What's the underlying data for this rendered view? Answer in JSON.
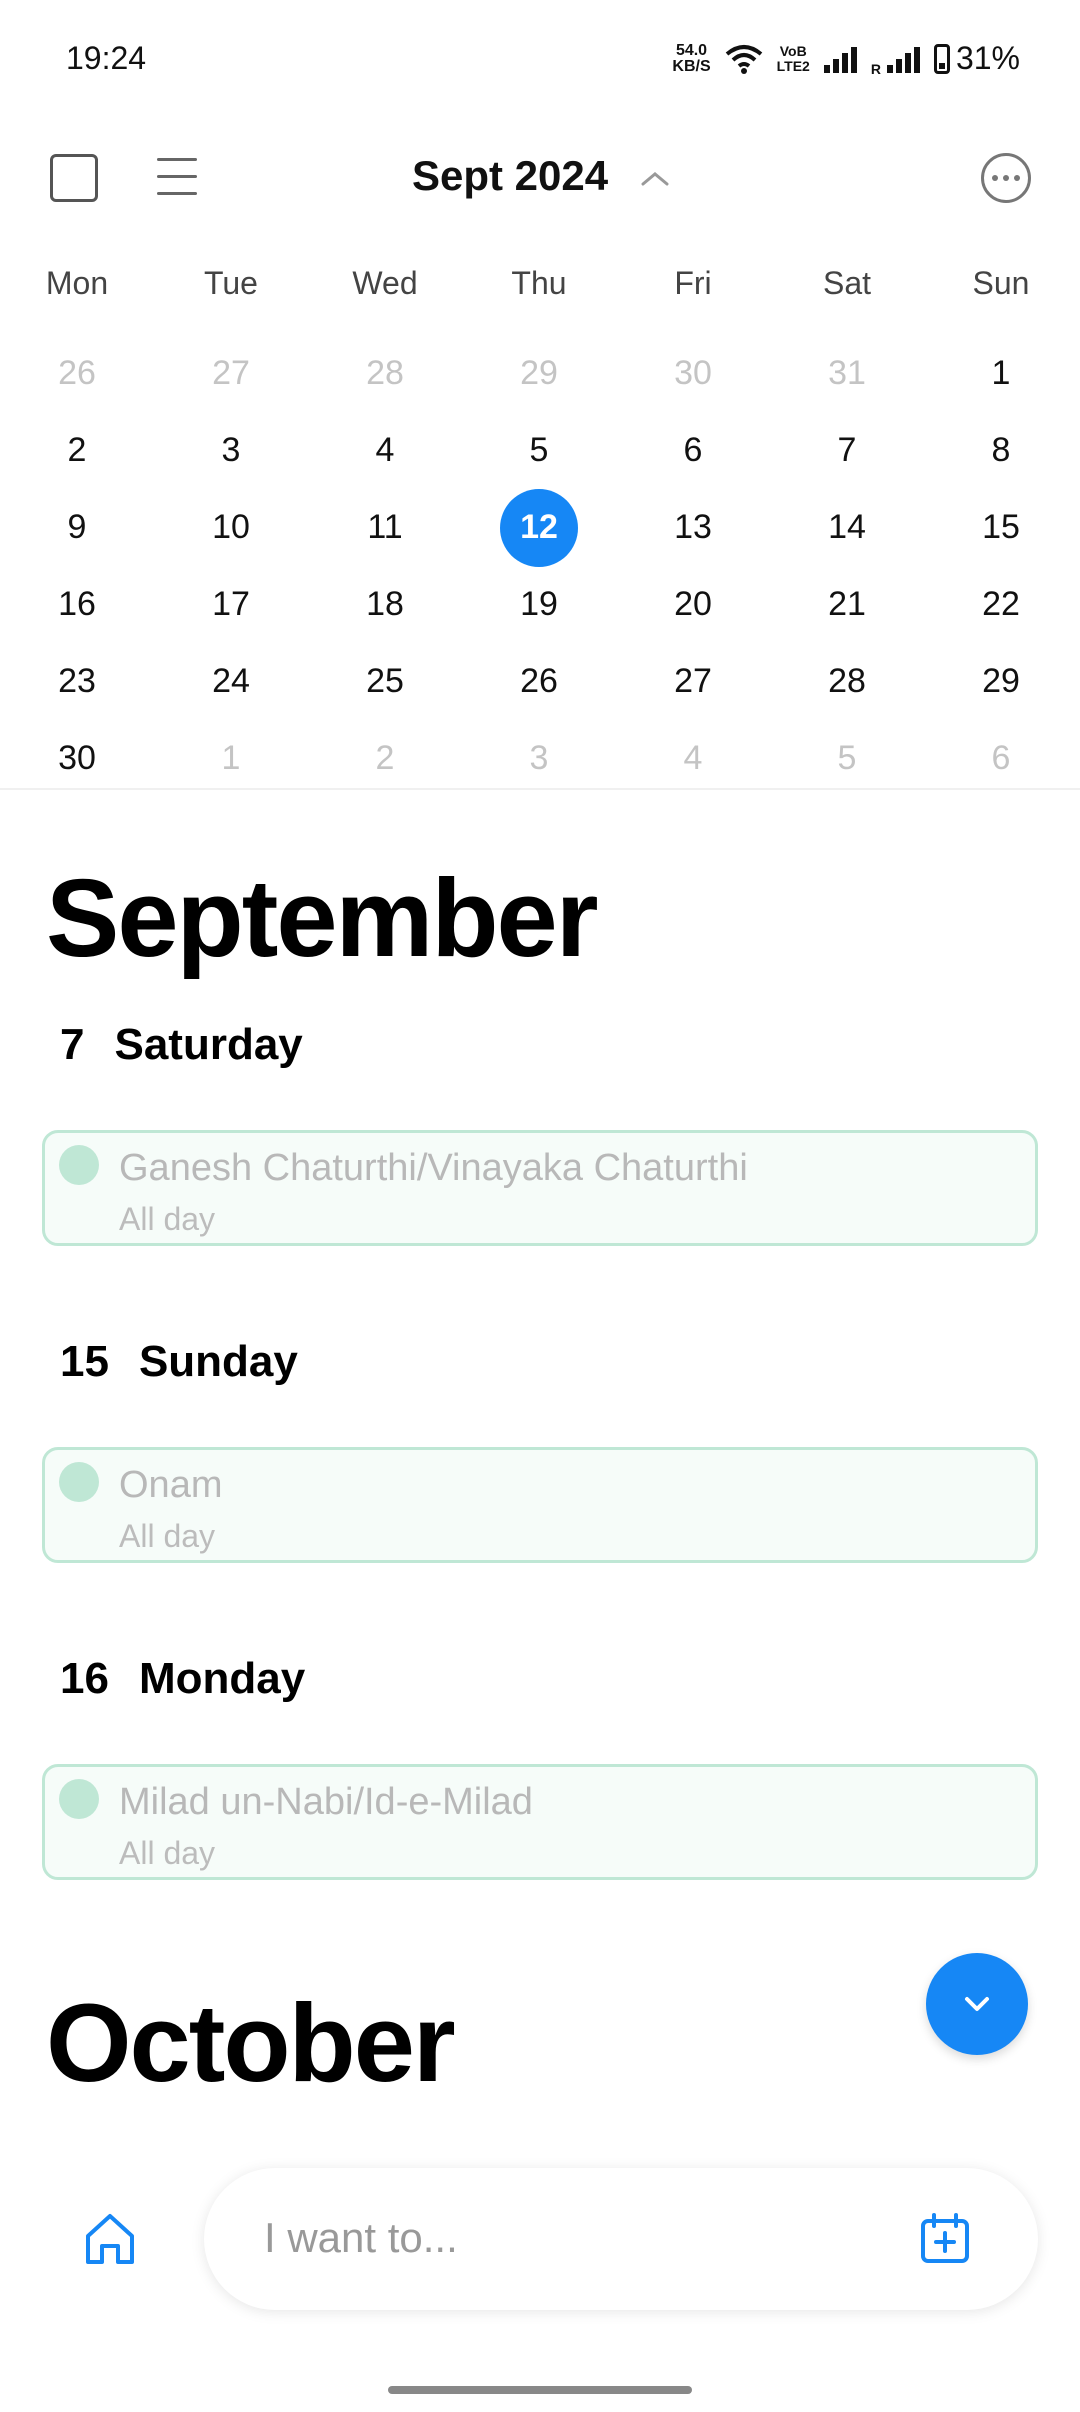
{
  "status": {
    "time": "19:24",
    "net_speed_value": "54.0",
    "net_speed_unit": "KB/S",
    "volte_top": "VoB",
    "volte_bottom": "LTE2",
    "roaming": "R",
    "battery": "31%"
  },
  "header": {
    "month_title": "Sept 2024",
    "left_icon_1": "square-icon",
    "left_icon_2": "menu-icon",
    "right_icon": "more-icon"
  },
  "calendar": {
    "weekdays": [
      "Mon",
      "Tue",
      "Wed",
      "Thu",
      "Fri",
      "Sat",
      "Sun"
    ],
    "weeks": [
      [
        "26",
        "27",
        "28",
        "29",
        "30",
        "31",
        "1"
      ],
      [
        "2",
        "3",
        "4",
        "5",
        "6",
        "7",
        "8"
      ],
      [
        "9",
        "10",
        "11",
        "12",
        "13",
        "14",
        "15"
      ],
      [
        "16",
        "17",
        "18",
        "19",
        "20",
        "21",
        "22"
      ],
      [
        "23",
        "24",
        "25",
        "26",
        "27",
        "28",
        "29"
      ],
      [
        "30",
        "1",
        "2",
        "3",
        "4",
        "5",
        "6"
      ]
    ],
    "today": "12",
    "today_color": "#1687f5"
  },
  "agenda": {
    "month1": "September",
    "days": [
      {
        "num": "7",
        "weekday": "Saturday",
        "event_title": "Ganesh Chaturthi/Vinayaka Chaturthi",
        "event_time": "All day"
      },
      {
        "num": "15",
        "weekday": "Sunday",
        "event_title": "Onam",
        "event_time": "All day"
      },
      {
        "num": "16",
        "weekday": "Monday",
        "event_title": "Milad un-Nabi/Id-e-Milad",
        "event_time": "All day"
      }
    ],
    "month2": "October",
    "event_color": "#bfe7d5"
  },
  "bottom": {
    "input_placeholder": "I want to...",
    "home_icon": "home-icon",
    "add_icon": "calendar-add-icon"
  }
}
